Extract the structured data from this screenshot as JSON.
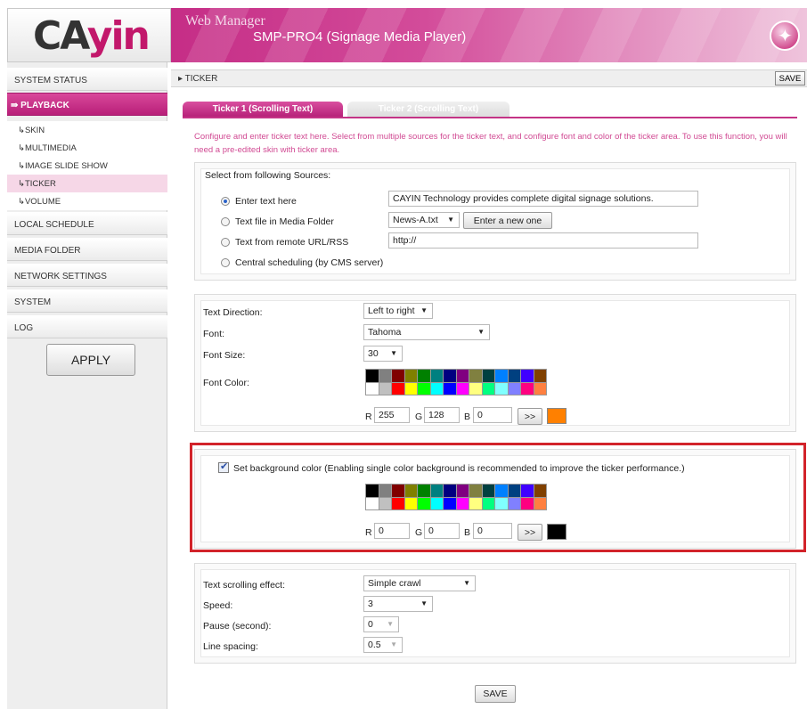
{
  "header": {
    "logo": "CAYIN",
    "title": "Web Manager",
    "subtitle": "SMP-PRO4 (Signage Media Player)"
  },
  "sidebar": {
    "items": [
      {
        "label": "SYSTEM STATUS"
      },
      {
        "label": "PLAYBACK"
      },
      {
        "label": "LOCAL SCHEDULE"
      },
      {
        "label": "MEDIA FOLDER"
      },
      {
        "label": "NETWORK SETTINGS"
      },
      {
        "label": "SYSTEM"
      },
      {
        "label": "LOG"
      }
    ],
    "playback_sub": [
      {
        "label": "SKIN"
      },
      {
        "label": "MULTIMEDIA"
      },
      {
        "label": "IMAGE SLIDE SHOW"
      },
      {
        "label": "TICKER"
      },
      {
        "label": "VOLUME"
      }
    ],
    "apply_label": "APPLY"
  },
  "content": {
    "title": "TICKER",
    "save_label": "SAVE",
    "tabs": [
      {
        "label": "Ticker 1 (Scrolling Text)",
        "active": true
      },
      {
        "label": "Ticker 2 (Scrolling Text)",
        "active": false
      }
    ],
    "intro": "Configure and enter ticker text here. Select from multiple sources for the ticker text, and configure font and color of the ticker area. To use this function, you will need a pre-edited skin with ticker area."
  },
  "sources": {
    "heading": "Select from following Sources:",
    "options": [
      {
        "label": "Enter text here",
        "selected": true
      },
      {
        "label": "Text file in Media Folder",
        "selected": false
      },
      {
        "label": "Text from remote URL/RSS",
        "selected": false
      },
      {
        "label": "Central scheduling (by CMS server)",
        "selected": false
      }
    ],
    "text_value": "CAYIN Technology provides complete digital signage solutions.",
    "file_value": "News-A.txt",
    "new_one_label": "Enter a new one",
    "url_value": "http://"
  },
  "font": {
    "direction_label": "Text Direction:",
    "direction_value": "Left to right",
    "font_label": "Font:",
    "font_value": "Tahoma",
    "size_label": "Font Size:",
    "size_value": "30",
    "color_label": "Font Color:",
    "r_label": "R",
    "r_value": "255",
    "g_label": "G",
    "g_value": "128",
    "b_label": "B",
    "b_value": "0",
    "apply_rgb_label": ">>",
    "preview_color": "#ff8000"
  },
  "background": {
    "checkbox_label": "Set background color (Enabling single color background is recommended to improve the ticker performance.)",
    "checked": true,
    "r_label": "R",
    "r_value": "0",
    "g_label": "G",
    "g_value": "0",
    "b_label": "B",
    "b_value": "0",
    "apply_rgb_label": ">>",
    "preview_color": "#000000"
  },
  "palette_colors": [
    "#000000",
    "#808080",
    "#800000",
    "#808000",
    "#008000",
    "#008080",
    "#000080",
    "#800080",
    "#808040",
    "#004040",
    "#0080ff",
    "#004080",
    "#4000ff",
    "#804000",
    "#ffffff",
    "#c0c0c0",
    "#ff0000",
    "#ffff00",
    "#00ff00",
    "#00ffff",
    "#0000ff",
    "#ff00ff",
    "#ffff80",
    "#00ff80",
    "#80ffff",
    "#8080ff",
    "#ff0080",
    "#ff8040"
  ],
  "scrolling": {
    "effect_label": "Text scrolling effect:",
    "effect_value": "Simple crawl",
    "speed_label": "Speed:",
    "speed_value": "3",
    "pause_label": "Pause (second):",
    "pause_value": "0",
    "spacing_label": "Line spacing:",
    "spacing_value": "0.5"
  },
  "bottom_save_label": "SAVE"
}
